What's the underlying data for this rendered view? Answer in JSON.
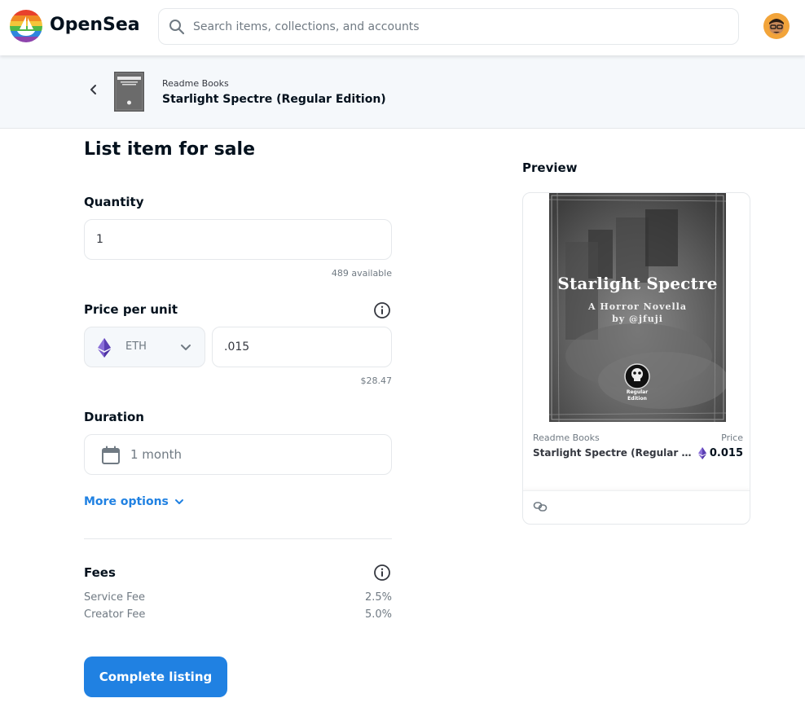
{
  "header": {
    "brand": "OpenSea",
    "search_placeholder": "Search items, collections, and accounts"
  },
  "subheader": {
    "collection": "Readme Books",
    "item_name": "Starlight Spectre (Regular Edition)"
  },
  "form": {
    "title": "List item for sale",
    "quantity": {
      "label": "Quantity",
      "value": "1",
      "available": "489 available"
    },
    "price": {
      "label": "Price per unit",
      "currency": "ETH",
      "value": ".015",
      "usd": "$28.47"
    },
    "duration": {
      "label": "Duration",
      "value": "1 month"
    },
    "more_options": "More options",
    "fees": {
      "label": "Fees",
      "items": [
        {
          "name": "Service Fee",
          "value": "2.5%"
        },
        {
          "name": "Creator Fee",
          "value": "5.0%"
        }
      ]
    },
    "submit_label": "Complete listing"
  },
  "preview": {
    "title": "Preview",
    "art_title": "Starlight Spectre",
    "art_subtitle": "A Horror Novella",
    "art_byline": "by @jfuji",
    "art_edition_line1": "Regular",
    "art_edition_line2": "Edition",
    "collection": "Readme Books",
    "price_label": "Price",
    "name": "Starlight Spectre (Regular Edition)",
    "price": "0.015"
  },
  "colors": {
    "accent": "#2081e2",
    "eth": "#6c4fbf"
  }
}
